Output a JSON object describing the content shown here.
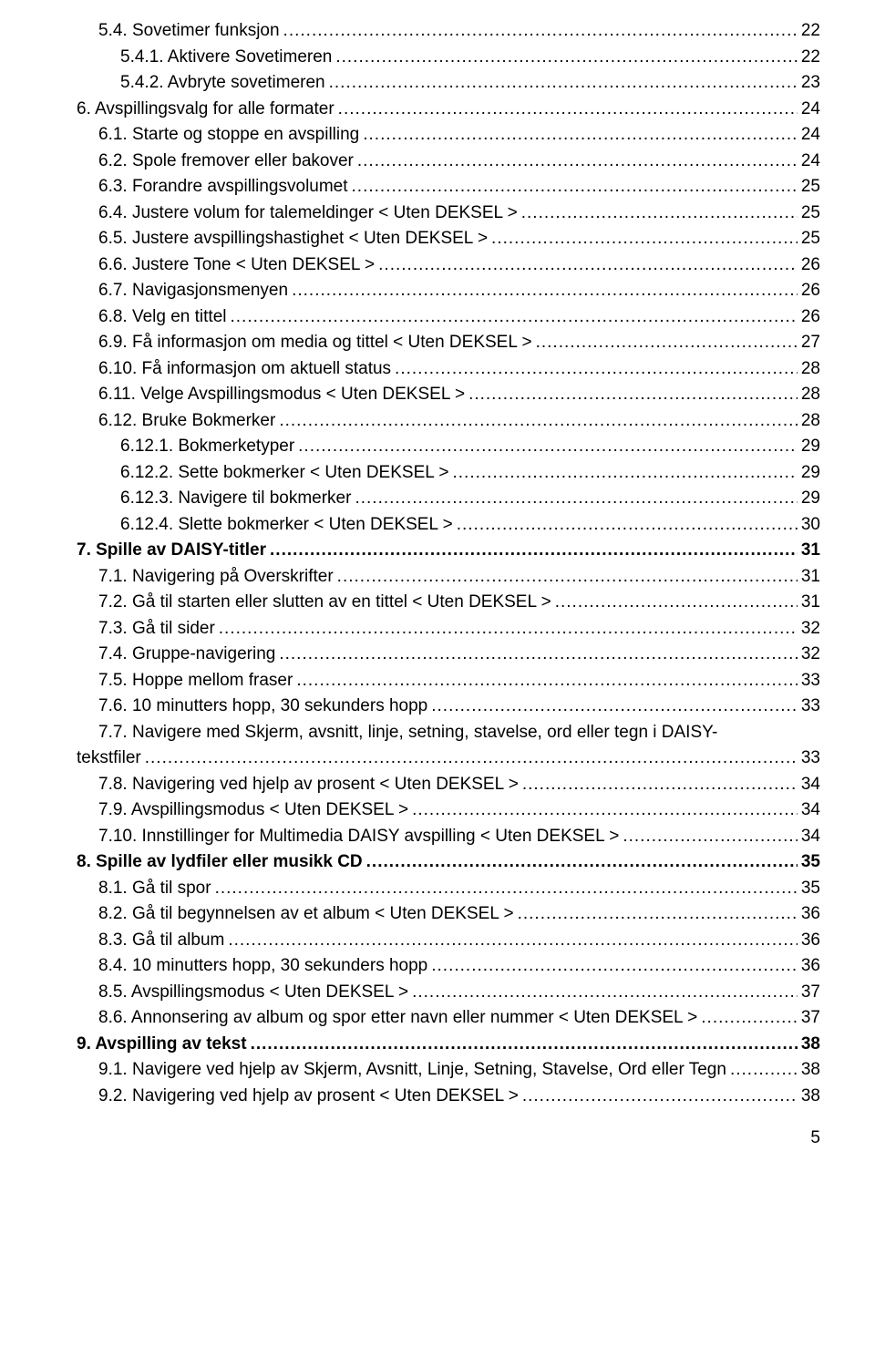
{
  "entries": [
    {
      "indent": 2,
      "bold": false,
      "label": "5.4. Sovetimer funksjon",
      "page": "22"
    },
    {
      "indent": 3,
      "bold": false,
      "label": "5.4.1. Aktivere Sovetimeren",
      "page": "22"
    },
    {
      "indent": 3,
      "bold": false,
      "label": "5.4.2. Avbryte sovetimeren",
      "page": "23"
    },
    {
      "indent": 1,
      "bold": false,
      "label": "6. Avspillingsvalg for alle formater",
      "page": "24"
    },
    {
      "indent": 2,
      "bold": false,
      "label": "6.1. Starte og stoppe en avspilling",
      "page": "24"
    },
    {
      "indent": 2,
      "bold": false,
      "label": "6.2. Spole fremover eller bakover",
      "page": "24"
    },
    {
      "indent": 2,
      "bold": false,
      "label": "6.3. Forandre avspillingsvolumet",
      "page": "25"
    },
    {
      "indent": 2,
      "bold": false,
      "label": "6.4. Justere volum for talemeldinger < Uten DEKSEL >",
      "page": "25"
    },
    {
      "indent": 2,
      "bold": false,
      "label": "6.5. Justere avspillingshastighet < Uten DEKSEL >",
      "page": "25"
    },
    {
      "indent": 2,
      "bold": false,
      "label": "6.6. Justere Tone < Uten DEKSEL >",
      "page": "26"
    },
    {
      "indent": 2,
      "bold": false,
      "label": "6.7. Navigasjonsmenyen",
      "page": "26"
    },
    {
      "indent": 2,
      "bold": false,
      "label": "6.8. Velg en tittel",
      "page": "26"
    },
    {
      "indent": 2,
      "bold": false,
      "label": "6.9. Få informasjon om media og tittel < Uten DEKSEL >",
      "page": "27"
    },
    {
      "indent": 2,
      "bold": false,
      "label": "6.10. Få informasjon om aktuell status",
      "page": "28"
    },
    {
      "indent": 2,
      "bold": false,
      "label": "6.11. Velge Avspillingsmodus < Uten DEKSEL >",
      "page": "28"
    },
    {
      "indent": 2,
      "bold": false,
      "label": "6.12. Bruke Bokmerker",
      "page": "28"
    },
    {
      "indent": 3,
      "bold": false,
      "label": "6.12.1. Bokmerketyper",
      "page": "29"
    },
    {
      "indent": 3,
      "bold": false,
      "label": "6.12.2. Sette bokmerker < Uten DEKSEL >",
      "page": "29"
    },
    {
      "indent": 3,
      "bold": false,
      "label": "6.12.3. Navigere til bokmerker",
      "page": "29"
    },
    {
      "indent": 3,
      "bold": false,
      "label": "6.12.4. Slette bokmerker < Uten DEKSEL >",
      "page": "30"
    },
    {
      "indent": 1,
      "bold": true,
      "label": "7. Spille av DAISY-titler",
      "page": "31"
    },
    {
      "indent": 2,
      "bold": false,
      "label": "7.1. Navigering på Overskrifter",
      "page": "31"
    },
    {
      "indent": 2,
      "bold": false,
      "label": "7.2. Gå til starten eller slutten av en tittel < Uten DEKSEL >",
      "page": "31"
    },
    {
      "indent": 2,
      "bold": false,
      "label": "7.3. Gå til sider",
      "page": "32"
    },
    {
      "indent": 2,
      "bold": false,
      "label": "7.4. Gruppe-navigering",
      "page": "32"
    },
    {
      "indent": 2,
      "bold": false,
      "label": "7.5. Hoppe mellom fraser",
      "page": "33"
    },
    {
      "indent": 2,
      "bold": false,
      "label": "7.6. 10 minutters hopp, 30 sekunders hopp",
      "page": "33"
    },
    {
      "indent": 2,
      "bold": false,
      "wrap": true,
      "label_line1": "7.7. Navigere med Skjerm, avsnitt, linje, setning, stavelse, ord eller tegn i DAISY-",
      "label_line2": "tekstfiler",
      "page": "33"
    },
    {
      "indent": 2,
      "bold": false,
      "label": "7.8. Navigering ved hjelp av prosent < Uten DEKSEL >",
      "page": "34"
    },
    {
      "indent": 2,
      "bold": false,
      "label": "7.9. Avspillingsmodus < Uten DEKSEL >",
      "page": "34"
    },
    {
      "indent": 2,
      "bold": false,
      "label": "7.10. Innstillinger for Multimedia DAISY avspilling < Uten DEKSEL >",
      "page": "34"
    },
    {
      "indent": 1,
      "bold": true,
      "label": "8. Spille av lydfiler eller musikk CD",
      "page": "35"
    },
    {
      "indent": 2,
      "bold": false,
      "label": "8.1. Gå til spor",
      "page": "35"
    },
    {
      "indent": 2,
      "bold": false,
      "label": "8.2. Gå til begynnelsen av et album < Uten DEKSEL >",
      "page": "36"
    },
    {
      "indent": 2,
      "bold": false,
      "label": "8.3. Gå til album",
      "page": "36"
    },
    {
      "indent": 2,
      "bold": false,
      "label": "8.4. 10 minutters hopp, 30 sekunders hopp",
      "page": "36"
    },
    {
      "indent": 2,
      "bold": false,
      "label": "8.5. Avspillingsmodus < Uten DEKSEL >",
      "page": "37"
    },
    {
      "indent": 2,
      "bold": false,
      "label": "8.6. Annonsering av album og spor etter navn eller nummer < Uten DEKSEL >",
      "page": "37"
    },
    {
      "indent": 1,
      "bold": true,
      "label": "9. Avspilling av tekst",
      "page": "38"
    },
    {
      "indent": 2,
      "bold": false,
      "label": "9.1. Navigere ved hjelp av Skjerm, Avsnitt, Linje, Setning, Stavelse, Ord eller Tegn",
      "page": "38"
    },
    {
      "indent": 2,
      "bold": false,
      "label": "9.2. Navigering ved hjelp av prosent < Uten DEKSEL >",
      "page": "38"
    }
  ],
  "page_number": "5"
}
